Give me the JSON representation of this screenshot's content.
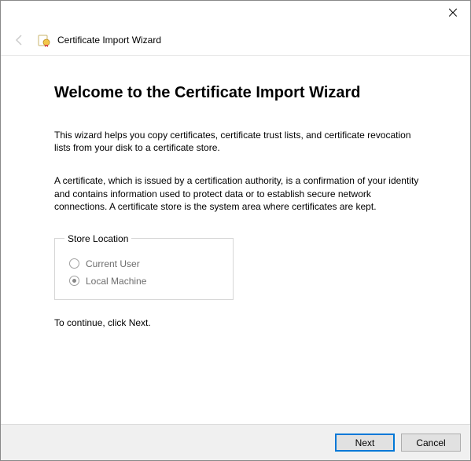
{
  "window": {
    "close_label": "Close"
  },
  "header": {
    "title": "Certificate Import Wizard"
  },
  "page": {
    "title": "Welcome to the Certificate Import Wizard",
    "intro": "This wizard helps you copy certificates, certificate trust lists, and certificate revocation lists from your disk to a certificate store.",
    "description": "A certificate, which is issued by a certification authority, is a confirmation of your identity and contains information used to protect data or to establish secure network connections. A certificate store is the system area where certificates are kept.",
    "continue_text": "To continue, click Next."
  },
  "store_location": {
    "legend": "Store Location",
    "options": {
      "current_user": "Current User",
      "local_machine": "Local Machine"
    },
    "selected": "local_machine",
    "disabled": true
  },
  "footer": {
    "next": "Next",
    "cancel": "Cancel"
  }
}
